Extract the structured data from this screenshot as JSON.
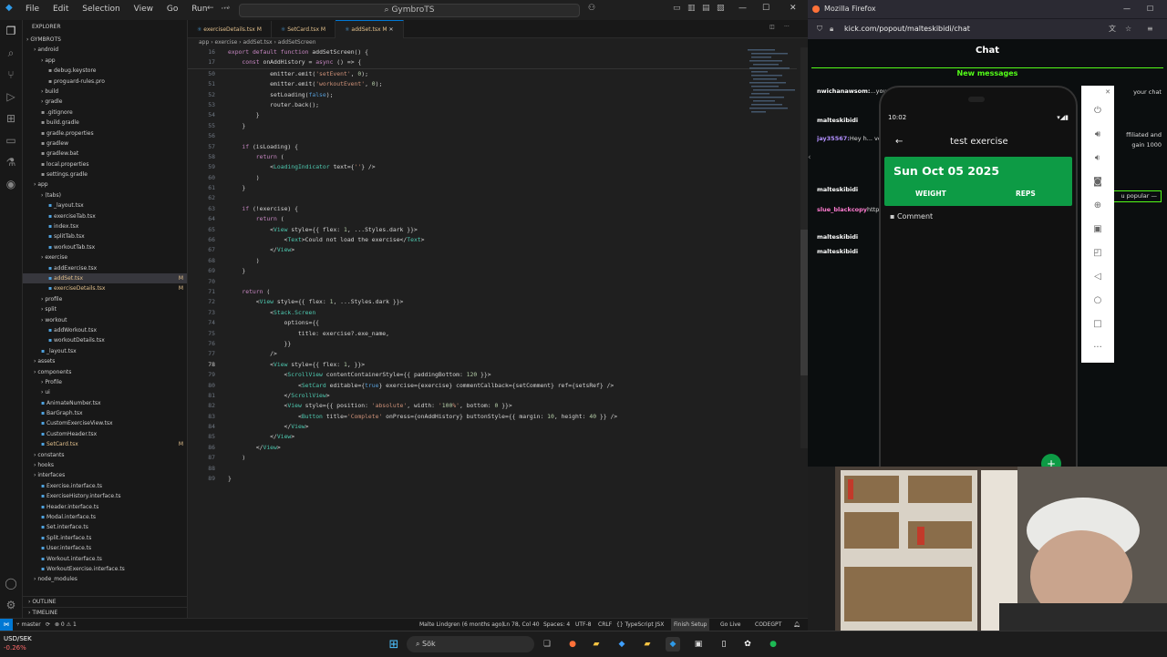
{
  "vscode": {
    "menu": [
      "File",
      "Edit",
      "Selection",
      "View",
      "Go",
      "Run"
    ],
    "nav_back": "←",
    "nav_forward": "→",
    "search_placeholder": "GymbroTS",
    "window_controls": [
      "—",
      "☐",
      "✕"
    ],
    "explorer_title": "EXPLORER",
    "tree": [
      {
        "label": "GYMBROTS",
        "indent": 0,
        "kind": "root"
      },
      {
        "label": "android",
        "indent": 1,
        "kind": "folder"
      },
      {
        "label": "app",
        "indent": 2,
        "kind": "folder"
      },
      {
        "label": "debug.keystore",
        "indent": 3,
        "kind": "file"
      },
      {
        "label": "proguard-rules.pro",
        "indent": 3,
        "kind": "file"
      },
      {
        "label": "build",
        "indent": 2,
        "kind": "folder"
      },
      {
        "label": "gradle",
        "indent": 2,
        "kind": "folder"
      },
      {
        "label": ".gitignore",
        "indent": 2,
        "kind": "file"
      },
      {
        "label": "build.gradle",
        "indent": 2,
        "kind": "file"
      },
      {
        "label": "gradle.properties",
        "indent": 2,
        "kind": "file"
      },
      {
        "label": "gradlew",
        "indent": 2,
        "kind": "file"
      },
      {
        "label": "gradlew.bat",
        "indent": 2,
        "kind": "file"
      },
      {
        "label": "local.properties",
        "indent": 2,
        "kind": "file"
      },
      {
        "label": "settings.gradle",
        "indent": 2,
        "kind": "file"
      },
      {
        "label": "app",
        "indent": 1,
        "kind": "folder"
      },
      {
        "label": "(tabs)",
        "indent": 2,
        "kind": "folder"
      },
      {
        "label": "_layout.tsx",
        "indent": 3,
        "kind": "file"
      },
      {
        "label": "exerciseTab.tsx",
        "indent": 3,
        "kind": "file"
      },
      {
        "label": "index.tsx",
        "indent": 3,
        "kind": "file"
      },
      {
        "label": "splitTab.tsx",
        "indent": 3,
        "kind": "file"
      },
      {
        "label": "workoutTab.tsx",
        "indent": 3,
        "kind": "file"
      },
      {
        "label": "exercise",
        "indent": 2,
        "kind": "folder"
      },
      {
        "label": "addExercise.tsx",
        "indent": 3,
        "kind": "file"
      },
      {
        "label": "addSet.tsx",
        "indent": 3,
        "kind": "file",
        "mod": "M",
        "selected": true
      },
      {
        "label": "exerciseDetails.tsx",
        "indent": 3,
        "kind": "file",
        "mod": "M"
      },
      {
        "label": "profile",
        "indent": 2,
        "kind": "folder"
      },
      {
        "label": "split",
        "indent": 2,
        "kind": "folder"
      },
      {
        "label": "workout",
        "indent": 2,
        "kind": "folder"
      },
      {
        "label": "addWorkout.tsx",
        "indent": 3,
        "kind": "file"
      },
      {
        "label": "workoutDetails.tsx",
        "indent": 3,
        "kind": "file"
      },
      {
        "label": "_layout.tsx",
        "indent": 2,
        "kind": "file"
      },
      {
        "label": "assets",
        "indent": 1,
        "kind": "folder"
      },
      {
        "label": "components",
        "indent": 1,
        "kind": "folder"
      },
      {
        "label": "Profile",
        "indent": 2,
        "kind": "folder"
      },
      {
        "label": "ui",
        "indent": 2,
        "kind": "folder"
      },
      {
        "label": "AnimateNumber.tsx",
        "indent": 2,
        "kind": "file"
      },
      {
        "label": "BarGraph.tsx",
        "indent": 2,
        "kind": "file"
      },
      {
        "label": "CustomExerciseView.tsx",
        "indent": 2,
        "kind": "file"
      },
      {
        "label": "CustomHeader.tsx",
        "indent": 2,
        "kind": "file"
      },
      {
        "label": "SetCard.tsx",
        "indent": 2,
        "kind": "file",
        "mod": "M"
      },
      {
        "label": "constants",
        "indent": 1,
        "kind": "folder"
      },
      {
        "label": "hooks",
        "indent": 1,
        "kind": "folder"
      },
      {
        "label": "interfaces",
        "indent": 1,
        "kind": "folder"
      },
      {
        "label": "Exercise.interface.ts",
        "indent": 2,
        "kind": "file"
      },
      {
        "label": "ExerciseHistory.interface.ts",
        "indent": 2,
        "kind": "file"
      },
      {
        "label": "Header.interface.ts",
        "indent": 2,
        "kind": "file"
      },
      {
        "label": "Modal.interface.ts",
        "indent": 2,
        "kind": "file"
      },
      {
        "label": "Set.interface.ts",
        "indent": 2,
        "kind": "file"
      },
      {
        "label": "Split.interface.ts",
        "indent": 2,
        "kind": "file"
      },
      {
        "label": "User.interface.ts",
        "indent": 2,
        "kind": "file"
      },
      {
        "label": "Workout.interface.ts",
        "indent": 2,
        "kind": "file"
      },
      {
        "label": "WorkoutExercise.interface.ts",
        "indent": 2,
        "kind": "file"
      },
      {
        "label": "node_modules",
        "indent": 1,
        "kind": "folder"
      }
    ],
    "outline_label": "OUTLINE",
    "timeline_label": "TIMELINE",
    "tabs": [
      {
        "label": "exerciseDetails.tsx M",
        "active": false
      },
      {
        "label": "SetCard.tsx M",
        "active": false
      },
      {
        "label": "addSet.tsx M",
        "active": true
      }
    ],
    "breadcrumb": "app › exercise › addSet.tsx › addSetScreen",
    "sticky": [
      {
        "n": "16",
        "code": "export default function addSetScreen() {"
      },
      {
        "n": "17",
        "code": "    const onAddHistory = async () => {"
      }
    ],
    "code": [
      {
        "n": "50",
        "code": "            emitter.emit('setEvent', 0);"
      },
      {
        "n": "51",
        "code": "            emitter.emit('workoutEvent', 0);"
      },
      {
        "n": "52",
        "code": "            setLoading(false);"
      },
      {
        "n": "53",
        "code": "            router.back();"
      },
      {
        "n": "54",
        "code": "        }"
      },
      {
        "n": "55",
        "code": "    }"
      },
      {
        "n": "56",
        "code": ""
      },
      {
        "n": "57",
        "code": "    if (isLoading) {"
      },
      {
        "n": "58",
        "code": "        return ("
      },
      {
        "n": "59",
        "code": "            <LoadingIndicator text={''} />"
      },
      {
        "n": "60",
        "code": "        )"
      },
      {
        "n": "61",
        "code": "    }"
      },
      {
        "n": "62",
        "code": ""
      },
      {
        "n": "63",
        "code": "    if (!exercise) {"
      },
      {
        "n": "64",
        "code": "        return ("
      },
      {
        "n": "65",
        "code": "            <View style={{ flex: 1, ...Styles.dark }}>"
      },
      {
        "n": "66",
        "code": "                <Text>Could not load the exercise</Text>"
      },
      {
        "n": "67",
        "code": "            </View>"
      },
      {
        "n": "68",
        "code": "        )"
      },
      {
        "n": "69",
        "code": "    }"
      },
      {
        "n": "70",
        "code": ""
      },
      {
        "n": "71",
        "code": "    return ("
      },
      {
        "n": "72",
        "code": "        <View style={{ flex: 1, ...Styles.dark }}>"
      },
      {
        "n": "73",
        "code": "            <Stack.Screen"
      },
      {
        "n": "74",
        "code": "                options={{"
      },
      {
        "n": "75",
        "code": "                    title: exercise?.exe_name,"
      },
      {
        "n": "76",
        "code": "                }}"
      },
      {
        "n": "77",
        "code": "            />"
      },
      {
        "n": "78",
        "code": "            <View style={{ flex: 1, }}>"
      },
      {
        "n": "79",
        "code": "                <ScrollView contentContainerStyle={{ paddingBottom: 120 }}>"
      },
      {
        "n": "80",
        "code": "                    <SetCard editable={true} exercise={exercise} commentCallback={setComment} ref={setsRef} />"
      },
      {
        "n": "81",
        "code": "                </ScrollView>"
      },
      {
        "n": "82",
        "code": "                <View style={{ position: 'absolute', width: '100%', bottom: 0 }}>"
      },
      {
        "n": "83",
        "code": "                    <Button title='Complete' onPress={onAddHistory} buttonStyle={{ margin: 10, height: 40 }} />"
      },
      {
        "n": "84",
        "code": "                </View>"
      },
      {
        "n": "85",
        "code": "            </View>"
      },
      {
        "n": "86",
        "code": "        </View>"
      },
      {
        "n": "87",
        "code": "    )"
      },
      {
        "n": "88",
        "code": ""
      },
      {
        "n": "89",
        "code": "}"
      }
    ],
    "status": {
      "branch": "master",
      "sync": "⟳",
      "errors": "⊗ 0 ⚠ 1",
      "ports": "⚲ 0",
      "blame": "Malte Lindgren (6 months ago)",
      "cursor": "Ln 78, Col 40",
      "spaces": "Spaces: 4",
      "encoding": "UTF-8",
      "eol": "CRLF",
      "lang": "{} TypeScript JSX",
      "finish": "Finish Setup",
      "golive": "Go Live",
      "codegpt": "CODEGPT"
    }
  },
  "firefox": {
    "window_title": "Mozilla Firefox",
    "url": "kick.com/popout/malteskibidi/chat",
    "chat_title": "Chat",
    "new_messages": "New messages",
    "chat_lines": [
      {
        "user": "nwichanawsom:",
        "color": "#ffffff",
        "text": "...your chat active and help..."
      },
      {
        "user": "malteskibidi",
        "color": "#ffffff",
        "text": ""
      },
      {
        "user": "jay35567:",
        "color": "#b28fff",
        "text": "Hey h... verified. I get a p... Active audience ... Interested>>>fr..."
      },
      {
        "user": "malteskibidi",
        "color": "#ffffff",
        "text": ""
      },
      {
        "user": "slue_blackcopy",
        "color": "#ff7bd0",
        "text": "https://nezhna.c..."
      },
      {
        "user": "malteskibidi",
        "color": "#ffffff",
        "text": ""
      },
      {
        "user": "malteskibidi",
        "color": "#ffffff",
        "text": ""
      }
    ],
    "right_fragments": [
      "your chat",
      "ffiliated and",
      "gain 1000",
      "u popular —"
    ]
  },
  "phone": {
    "time": "10:02",
    "status_icons": "▾◢▮",
    "app_title": "test exercise",
    "date": "Sun Oct 05 2025",
    "col_weight": "WEIGHT",
    "col_reps": "REPS",
    "comment_label": "Comment",
    "fab": "+"
  },
  "taskbar": {
    "ticker_symbol": "USD/SEK",
    "ticker_change": "-0.26%",
    "search_placeholder": "Sök"
  },
  "colors": {
    "accent_green": "#0d9b45",
    "kick_green": "#53fc18",
    "vscode_blue": "#0078d4"
  }
}
